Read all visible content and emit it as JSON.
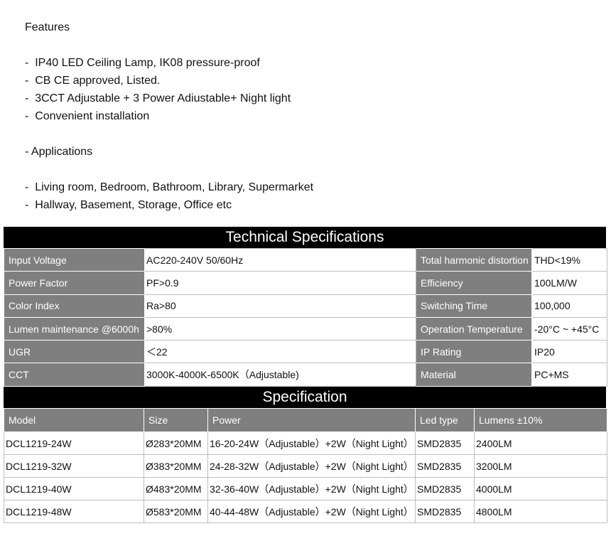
{
  "features": {
    "heading": "Features",
    "items": [
      "-  IP40 LED Ceiling Lamp, IK08 pressure-proof",
      "-  CB CE approved, Listed.",
      "-  3CCT Adjustable + 3 Power Adiustable+ Night light",
      "-  Convenient installation"
    ]
  },
  "applications": {
    "heading": "- Applications",
    "items": [
      "-  Living room, Bedroom, Bathroom, Library, Supermarket",
      "-  Hallway, Basement, Storage, Office etc"
    ]
  },
  "technical": {
    "title": "Technical Specifications",
    "rows": [
      {
        "l1": "Input Voltage",
        "v1": "AC220-240V  50/60Hz",
        "l2": "Total harmonic distortion",
        "v2": "THD<19%"
      },
      {
        "l1": "Power Factor",
        "v1": "PF>0.9",
        "l2": "Efficiency",
        "v2": "100LM/W"
      },
      {
        "l1": "Color Index",
        "v1": "Ra>80",
        "l2": "Switching Time",
        "v2": "100,000"
      },
      {
        "l1": "Lumen maintenance @6000h",
        "v1": ">80%",
        "l2": "Operation Temperature",
        "v2": " -20°C ~ +45°C"
      },
      {
        "l1": "UGR",
        "v1": "＜22",
        "l2": "IP Rating",
        "v2": "IP20"
      },
      {
        "l1": "CCT",
        "v1": "3000K-4000K-6500K（Adjustable)",
        "l2": "Material",
        "v2": "PC+MS"
      }
    ]
  },
  "specification": {
    "title": "Specification",
    "headers": [
      "Model",
      "Size",
      "Power",
      "Led type",
      "Lumens  ±10%"
    ],
    "rows": [
      [
        "DCL1219-24W",
        "Ø283*20MM",
        "16-20-24W（Adjustable）+2W（Night Light）",
        "SMD2835",
        "2400LM"
      ],
      [
        "DCL1219-32W",
        "Ø383*20MM",
        "24-28-32W（Adjustable）+2W（Night Light）",
        "SMD2835",
        "3200LM"
      ],
      [
        "DCL1219-40W",
        "Ø483*20MM",
        "32-36-40W（Adjustable）+2W（Night Light）",
        "SMD2835",
        "4000LM"
      ],
      [
        "DCL1219-48W",
        "Ø583*20MM",
        "40-44-48W（Adjustable）+2W（Night Light）",
        "SMD2835",
        "4800LM"
      ]
    ]
  }
}
